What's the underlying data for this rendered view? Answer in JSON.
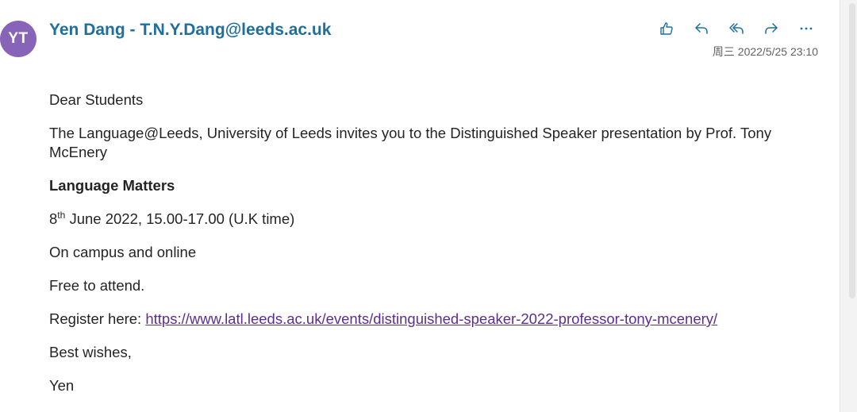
{
  "sender": {
    "initials": "YT",
    "display": "Yen Dang - T.N.Y.Dang@leeds.ac.uk",
    "avatar_color": "#8764b8"
  },
  "timestamp": "周三 2022/5/25 23:10",
  "actions": [
    {
      "name": "like",
      "icon": "thumbs-up-icon"
    },
    {
      "name": "reply",
      "icon": "reply-icon"
    },
    {
      "name": "reply-all",
      "icon": "reply-all-icon"
    },
    {
      "name": "forward",
      "icon": "forward-icon"
    },
    {
      "name": "more",
      "icon": "more-icon"
    }
  ],
  "body": {
    "greeting": "Dear Students",
    "intro": "The Language@Leeds, University of Leeds invites you to the Distinguished Speaker presentation by Prof. Tony McEnery",
    "title": "Language Matters",
    "date_day": "8",
    "date_suffix": "th",
    "date_rest": " June 2022, 15.00-17.00 (U.K time)",
    "location": "On campus and online",
    "price": "Free to attend.",
    "register_label": "Register here: ",
    "register_link": "https://www.latl.leeds.ac.uk/events/distinguished-speaker-2022-professor-tony-mcenery/",
    "signoff": "Best wishes,",
    "signature": "Yen"
  },
  "colors": {
    "accent": "#1f6f9e",
    "link": "#5c2d91"
  }
}
